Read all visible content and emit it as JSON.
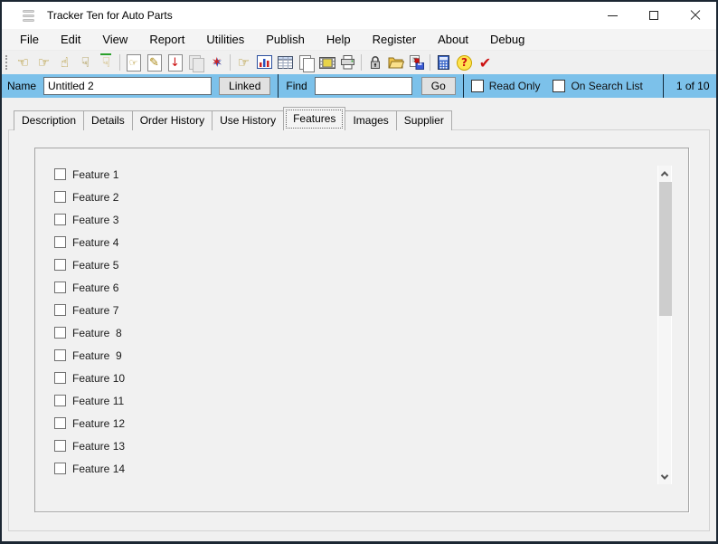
{
  "window": {
    "title": "Tracker Ten for Auto Parts"
  },
  "menu": {
    "items": [
      "File",
      "Edit",
      "View",
      "Report",
      "Utilities",
      "Publish",
      "Help",
      "Register",
      "About",
      "Debug"
    ]
  },
  "toolbar": {
    "icons": [
      {
        "name": "nav-prev-record-icon",
        "glyph": "☜"
      },
      {
        "name": "nav-next-record-icon",
        "glyph": "☞"
      },
      {
        "name": "hand-up-icon",
        "glyph": "☝"
      },
      {
        "name": "hand-down-icon",
        "glyph": "☟"
      },
      {
        "name": "hand-down-outline-icon",
        "glyph": "☟"
      },
      {
        "name": "new-record-icon",
        "glyph": "☞"
      },
      {
        "name": "edit-record-icon",
        "glyph": "✎"
      },
      {
        "name": "import-record-icon",
        "glyph": "↓"
      },
      {
        "name": "copy-record-disabled-icon",
        "glyph": ""
      },
      {
        "name": "delete-record-icon",
        "glyph": "✶"
      },
      {
        "name": "find-record-icon",
        "glyph": "☞"
      },
      {
        "name": "chart-icon",
        "glyph": ""
      },
      {
        "name": "table-icon",
        "glyph": ""
      },
      {
        "name": "copy-pages-icon",
        "glyph": ""
      },
      {
        "name": "filmstrip-icon",
        "glyph": ""
      },
      {
        "name": "print-icon",
        "glyph": ""
      },
      {
        "name": "lock-icon",
        "glyph": ""
      },
      {
        "name": "open-folder-icon",
        "glyph": ""
      },
      {
        "name": "save-export-icon",
        "glyph": ""
      },
      {
        "name": "calculator-icon",
        "glyph": ""
      },
      {
        "name": "help-icon",
        "glyph": "?"
      },
      {
        "name": "spellcheck-icon",
        "glyph": "✔"
      }
    ]
  },
  "record_bar": {
    "name_label": "Name",
    "name_value": "Untitled 2",
    "linked_label": "Linked",
    "find_label": "Find",
    "find_value": "",
    "go_label": "Go",
    "read_only_label": "Read Only",
    "read_only_checked": false,
    "on_search_list_label": "On Search List",
    "on_search_list_checked": false,
    "record_position": "1 of 10",
    "background_color": "#7cc1ea"
  },
  "tabs": {
    "selected": "Features",
    "items": [
      "Description",
      "Details",
      "Order History",
      "Use History",
      "Features",
      "Images",
      "Supplier"
    ]
  },
  "features": {
    "items": [
      {
        "label": "Feature 1",
        "checked": false
      },
      {
        "label": "Feature 2",
        "checked": false
      },
      {
        "label": "Feature 3",
        "checked": false
      },
      {
        "label": "Feature 4",
        "checked": false
      },
      {
        "label": "Feature 5",
        "checked": false
      },
      {
        "label": "Feature 6",
        "checked": false
      },
      {
        "label": "Feature 7",
        "checked": false
      },
      {
        "label": "Feature  8",
        "checked": false
      },
      {
        "label": "Feature  9",
        "checked": false
      },
      {
        "label": "Feature 10",
        "checked": false
      },
      {
        "label": "Feature 11",
        "checked": false
      },
      {
        "label": "Feature 12",
        "checked": false
      },
      {
        "label": "Feature 13",
        "checked": false
      },
      {
        "label": "Feature 14",
        "checked": false
      }
    ]
  },
  "colors": {
    "window_border": "#1c2733",
    "accent_blue": "#7cc1ea"
  }
}
